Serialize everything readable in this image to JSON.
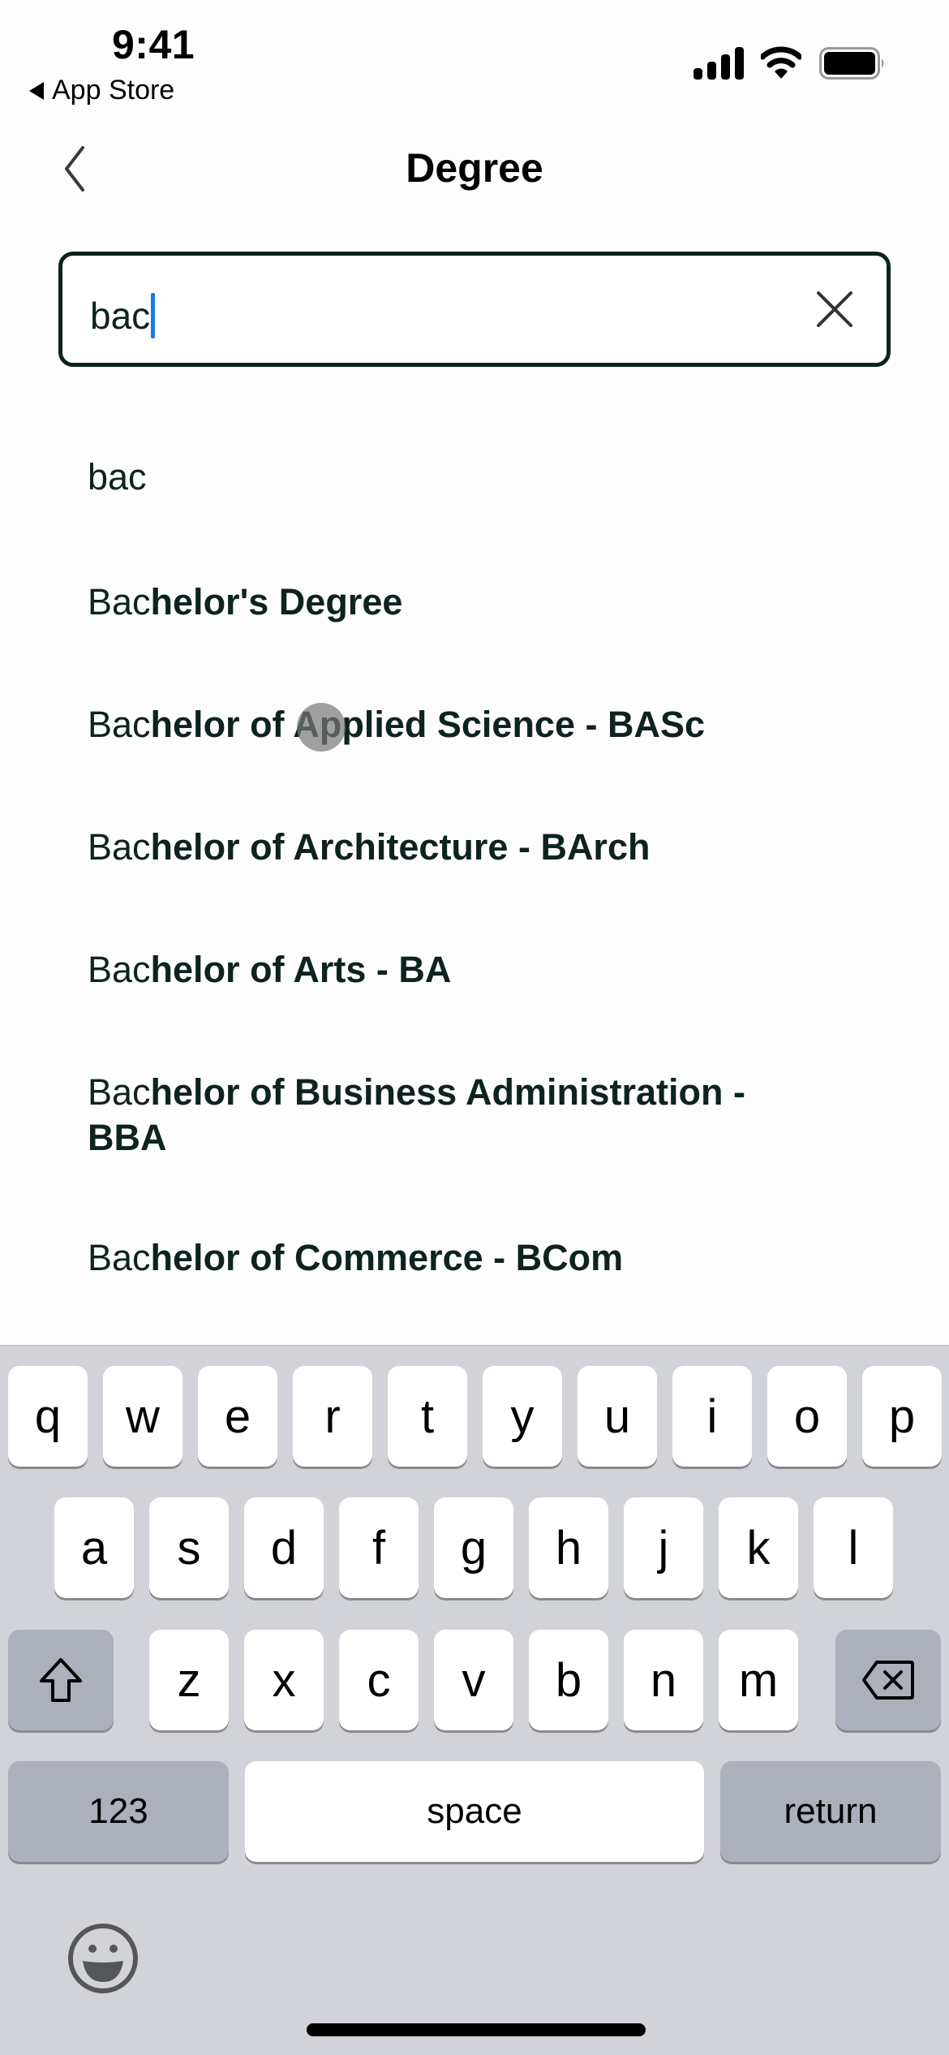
{
  "status_bar": {
    "time": "9:41",
    "back_app_label": "App Store",
    "icons": [
      "signal-icon",
      "wifi-icon",
      "battery-icon"
    ]
  },
  "nav": {
    "title": "Degree",
    "back_icon": "chevron-left-icon"
  },
  "search": {
    "value": "bac",
    "clear_icon": "close-icon"
  },
  "suggestions": [
    {
      "match": "bac",
      "rest": ""
    },
    {
      "match": "Bac",
      "rest": "helor's Degree"
    },
    {
      "match": "Bac",
      "rest": "helor of Applied Science - BASc"
    },
    {
      "match": "Bac",
      "rest": "helor of Architecture - BArch"
    },
    {
      "match": "Bac",
      "rest": "helor of Arts - BA"
    },
    {
      "match": "Bac",
      "rest": "helor of Business Administration - BBA"
    },
    {
      "match": "Bac",
      "rest": "helor of Commerce - BCom"
    }
  ],
  "keyboard": {
    "row1": [
      "q",
      "w",
      "e",
      "r",
      "t",
      "y",
      "u",
      "i",
      "o",
      "p"
    ],
    "row2": [
      "a",
      "s",
      "d",
      "f",
      "g",
      "h",
      "j",
      "k",
      "l"
    ],
    "row3": [
      "z",
      "x",
      "c",
      "v",
      "b",
      "n",
      "m"
    ],
    "numbers_label": "123",
    "space_label": "space",
    "return_label": "return",
    "shift_icon": "shift-icon",
    "delete_icon": "backspace-icon",
    "emoji_icon": "emoji-icon"
  },
  "colors": {
    "text_primary": "#0d2320",
    "caret": "#1a7be8",
    "keyboard_bg": "#d2d3d8",
    "key_dark": "#abb0bb"
  }
}
